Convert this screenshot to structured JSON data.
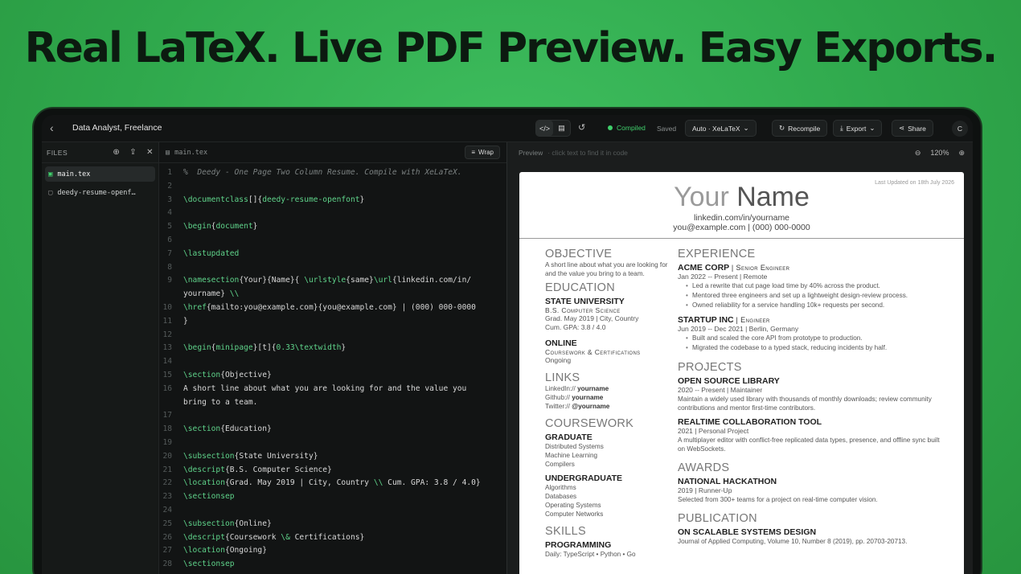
{
  "headline": "Real LaTeX. Live PDF Preview. Easy Exports.",
  "topbar": {
    "back_icon": "chevron-left-icon",
    "title": "Data Analyst, Freelance",
    "status": "Compiled",
    "saved": "Saved",
    "engine": "Auto · XeLaTeX",
    "recompile": "Recompile",
    "export": "Export",
    "share": "Share",
    "avatar": "C",
    "accent_color": "#3fcf6b"
  },
  "files": {
    "header": "FILES",
    "items": [
      {
        "label": "main.tex"
      },
      {
        "label": "deedy-resume-openf…"
      }
    ]
  },
  "editor": {
    "tab": "main.tex",
    "wrap": "Wrap",
    "lines": [
      {
        "n": "1",
        "html": "<span class='cm'>%  Deedy - One Page Two Column Resume. Compile with XeLaTeX.</span>"
      },
      {
        "n": "2",
        "html": ""
      },
      {
        "n": "3",
        "html": "<span class='kw'>\\documentclass</span>[]{<span class='kw'>deedy-resume-openfont</span>}"
      },
      {
        "n": "4",
        "html": ""
      },
      {
        "n": "5",
        "html": "<span class='kw'>\\begin</span>{<span class='kw'>document</span>}"
      },
      {
        "n": "6",
        "html": ""
      },
      {
        "n": "7",
        "html": "<span class='kw'>\\lastupdated</span>"
      },
      {
        "n": "8",
        "html": ""
      },
      {
        "n": "9",
        "html": "<span class='kw'>\\namesection</span>{Your}{Name}{ <span class='kw'>\\urlstyle</span>{same}<span class='kw'>\\url</span>{linkedin.com/in/\nyourname} <span class='kw'>\\\\</span>"
      },
      {
        "n": "10",
        "html": "<span class='kw'>\\href</span>{mailto:you@example.com}{you@example.com} | (000) 000-0000"
      },
      {
        "n": "11",
        "html": "}"
      },
      {
        "n": "12",
        "html": ""
      },
      {
        "n": "13",
        "html": "<span class='kw'>\\begin</span>{<span class='kw'>minipage</span>}[t]{<span class='kw'>0.33\\textwidth</span>}"
      },
      {
        "n": "14",
        "html": ""
      },
      {
        "n": "15",
        "html": "<span class='kw'>\\section</span>{Objective}"
      },
      {
        "n": "16",
        "html": "A short line about what you are looking for and the value you\nbring to a team."
      },
      {
        "n": "17",
        "html": ""
      },
      {
        "n": "18",
        "html": "<span class='kw'>\\section</span>{Education}"
      },
      {
        "n": "19",
        "html": ""
      },
      {
        "n": "20",
        "html": "<span class='kw'>\\subsection</span>{State University}"
      },
      {
        "n": "21",
        "html": "<span class='kw'>\\descript</span>{B.S. Computer Science}"
      },
      {
        "n": "22",
        "html": "<span class='kw'>\\location</span>{Grad. May 2019 | City, Country <span class='kw'>\\\\</span> Cum. GPA: 3.8 / 4.0}"
      },
      {
        "n": "23",
        "html": "<span class='kw'>\\sectionsep</span>"
      },
      {
        "n": "24",
        "html": ""
      },
      {
        "n": "25",
        "html": "<span class='kw'>\\subsection</span>{Online}"
      },
      {
        "n": "26",
        "html": "<span class='kw'>\\descript</span>{Coursework <span class='kw'>\\&amp;</span> Certifications}"
      },
      {
        "n": "27",
        "html": "<span class='kw'>\\location</span>{Ongoing}"
      },
      {
        "n": "28",
        "html": "<span class='kw'>\\sectionsep</span>"
      }
    ]
  },
  "preview": {
    "label": "Preview",
    "hint": "· click text to find it in code",
    "zoom": "120%",
    "page": {
      "last_updated": "Last Updated on 18th July 2026",
      "first": "Your",
      "last": "Name",
      "linkedin": "linkedin.com/in/yourname",
      "contact": "you@example.com | (000) 000-0000",
      "left": {
        "objective_title": "OBJECTIVE",
        "objective_text": "A short line about what you are looking for and the value you bring to a team.",
        "education_title": "EDUCATION",
        "edu1_name": "STATE UNIVERSITY",
        "edu1_desc": "B.S. Computer Science",
        "edu1_loc1": "Grad. May 2019 | City, Country",
        "edu1_loc2": "Cum. GPA: 3.8 / 4.0",
        "edu2_name": "ONLINE",
        "edu2_desc": "Coursework & Certifications",
        "edu2_loc": "Ongoing",
        "links_title": "LINKS",
        "link1_a": "LinkedIn://",
        "link1_b": "yourname",
        "link2_a": "Github://",
        "link2_b": "yourname",
        "link3_a": "Twitter://",
        "link3_b": "@yourname",
        "coursework_title": "COURSEWORK",
        "grad_title": "GRADUATE",
        "grad_1": "Distributed Systems",
        "grad_2": "Machine Learning",
        "grad_3": "Compilers",
        "ug_title": "UNDERGRADUATE",
        "ug_1": "Algorithms",
        "ug_2": "Databases",
        "ug_3": "Operating Systems",
        "ug_4": "Computer Networks",
        "skills_title": "SKILLS",
        "prog_title": "PROGRAMMING",
        "prog_list": "Daily: TypeScript • Python • Go"
      },
      "right": {
        "experience_title": "EXPERIENCE",
        "job1_co": "ACME CORP",
        "job1_role": "| Senior Engineer",
        "job1_when": "Jan 2022 -- Present | Remote",
        "job1_b1": "Led a rewrite that cut page load time by 40% across the product.",
        "job1_b2": "Mentored three engineers and set up a lightweight design-review process.",
        "job1_b3": "Owned reliability for a service handling 10k+ requests per second.",
        "job2_co": "STARTUP INC",
        "job2_role": "| Engineer",
        "job2_when": "Jun 2019 -- Dec 2021 | Berlin, Germany",
        "job2_b1": "Built and scaled the core API from prototype to production.",
        "job2_b2": "Migrated the codebase to a typed stack, reducing incidents by half.",
        "projects_title": "PROJECTS",
        "proj1_name": "OPEN SOURCE LIBRARY",
        "proj1_when": "2020 -- Present | Maintainer",
        "proj1_desc": "Maintain a widely used library with thousands of monthly downloads; review community contributions and mentor first-time contributors.",
        "proj2_name": "REALTIME COLLABORATION TOOL",
        "proj2_when": "2021 | Personal Project",
        "proj2_desc": "A multiplayer editor with conflict-free replicated data types, presence, and offline sync built on WebSockets.",
        "awards_title": "AWARDS",
        "award1_name": "NATIONAL HACKATHON",
        "award1_when": "2019 | Runner-Up",
        "award1_desc": "Selected from 300+ teams for a project on real-time computer vision.",
        "pub_title": "PUBLICATION",
        "pub1_name": "ON SCALABLE SYSTEMS DESIGN",
        "pub1_desc": "Journal of Applied Computing, Volume 10, Number 8 (2019), pp. 20703-20713."
      }
    }
  }
}
